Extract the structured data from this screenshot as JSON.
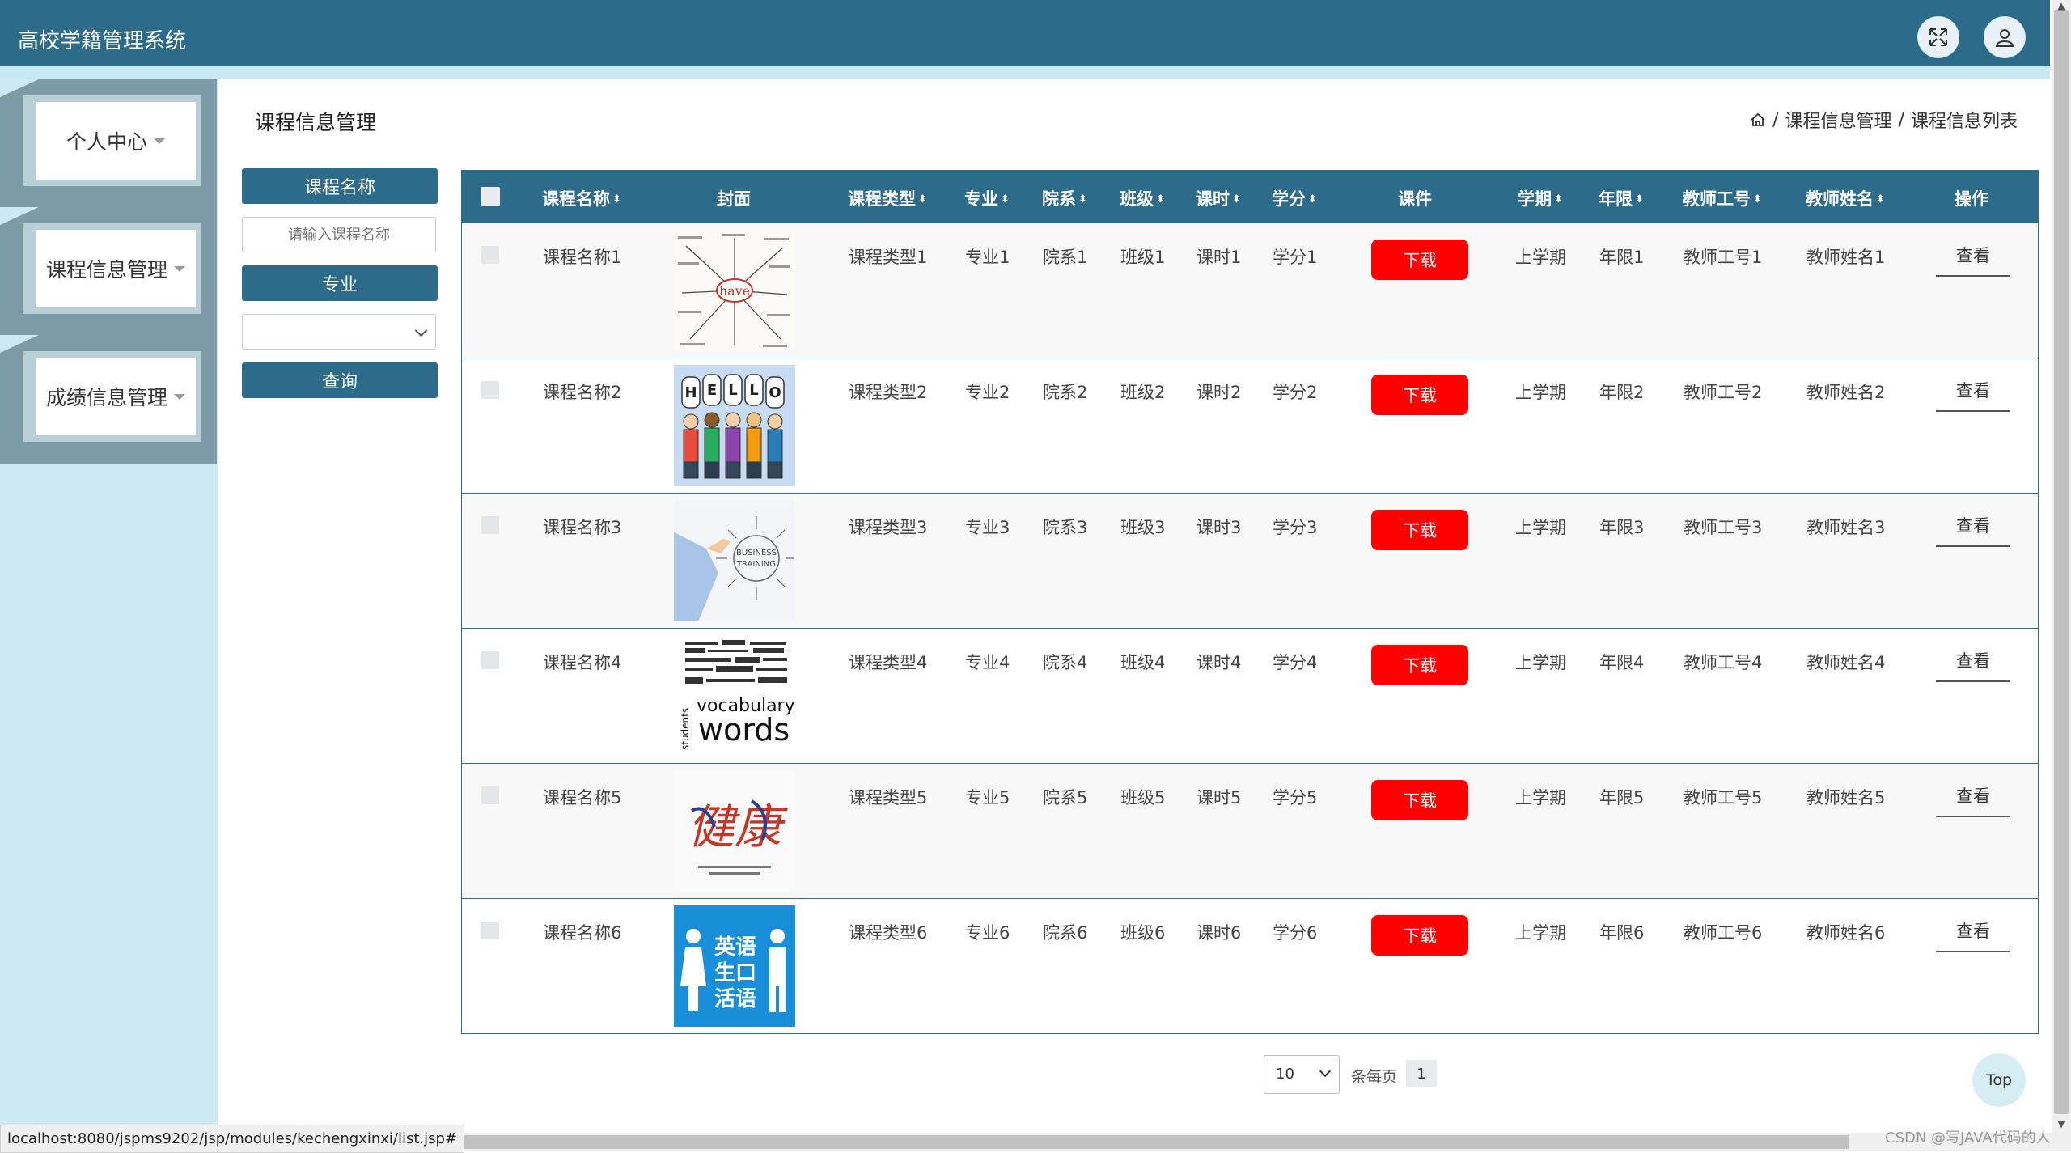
{
  "app": {
    "title": "高校学籍管理系统"
  },
  "header": {
    "fullscreen_icon": "expand-arrows-icon",
    "user_icon": "user-icon"
  },
  "sidebar": {
    "items": [
      {
        "label": "个人中心"
      },
      {
        "label": "课程信息管理"
      },
      {
        "label": "成绩信息管理"
      }
    ]
  },
  "page": {
    "title": "课程信息管理",
    "breadcrumb": {
      "home_icon": "home-icon",
      "sep1": "/",
      "level1": "课程信息管理",
      "sep2": "/",
      "level2": "课程信息列表"
    }
  },
  "filters": {
    "name_label": "课程名称",
    "name_placeholder": "请输入课程名称",
    "major_label": "专业",
    "major_value": "",
    "query_label": "查询"
  },
  "table": {
    "columns": [
      "课程名称",
      "封面",
      "课程类型",
      "专业",
      "院系",
      "班级",
      "课时",
      "学分",
      "课件",
      "学期",
      "年限",
      "教师工号",
      "教师姓名",
      "操作"
    ],
    "rows": [
      {
        "name": "课程名称1",
        "cover": "have-words-cover",
        "type": "课程类型1",
        "major": "专业1",
        "dept": "院系1",
        "class": "班级1",
        "hours": "课时1",
        "credit": "学分1",
        "download": "下载",
        "term": "上学期",
        "years": "年限1",
        "teacher_id": "教师工号1",
        "teacher_name": "教师姓名1",
        "action": "查看"
      },
      {
        "name": "课程名称2",
        "cover": "hello-kids-cover",
        "type": "课程类型2",
        "major": "专业2",
        "dept": "院系2",
        "class": "班级2",
        "hours": "课时2",
        "credit": "学分2",
        "download": "下载",
        "term": "上学期",
        "years": "年限2",
        "teacher_id": "教师工号2",
        "teacher_name": "教师姓名2",
        "action": "查看"
      },
      {
        "name": "课程名称3",
        "cover": "business-training-cover",
        "type": "课程类型3",
        "major": "专业3",
        "dept": "院系3",
        "class": "班级3",
        "hours": "课时3",
        "credit": "学分3",
        "download": "下载",
        "term": "上学期",
        "years": "年限3",
        "teacher_id": "教师工号3",
        "teacher_name": "教师姓名3",
        "action": "查看"
      },
      {
        "name": "课程名称4",
        "cover": "vocabulary-words-cover",
        "type": "课程类型4",
        "major": "专业4",
        "dept": "院系4",
        "class": "班级4",
        "hours": "课时4",
        "credit": "学分4",
        "download": "下载",
        "term": "上学期",
        "years": "年限4",
        "teacher_id": "教师工号4",
        "teacher_name": "教师姓名4",
        "action": "查看"
      },
      {
        "name": "课程名称5",
        "cover": "health-calligraphy-cover",
        "type": "课程类型5",
        "major": "专业5",
        "dept": "院系5",
        "class": "班级5",
        "hours": "课时5",
        "credit": "学分5",
        "download": "下载",
        "term": "上学期",
        "years": "年限5",
        "teacher_id": "教师工号5",
        "teacher_name": "教师姓名5",
        "action": "查看"
      },
      {
        "name": "课程名称6",
        "cover": "english-oral-cover",
        "type": "课程类型6",
        "major": "专业6",
        "dept": "院系6",
        "class": "班级6",
        "hours": "课时6",
        "credit": "学分6",
        "download": "下载",
        "term": "上学期",
        "years": "年限6",
        "teacher_id": "教师工号6",
        "teacher_name": "教师姓名6",
        "action": "查看"
      }
    ]
  },
  "covers": {
    "c1_word": "have",
    "c2_letters": [
      "H",
      "E",
      "L",
      "L",
      "O"
    ],
    "c3_line1": "BUSINESS",
    "c3_line2": "TRAINING",
    "c4_word1": "vocabulary",
    "c4_word2": "words",
    "c4_word3": "students",
    "c5_word": "健康",
    "c6_line1": "英语",
    "c6_line2": "生口",
    "c6_line3": "活语"
  },
  "pagination": {
    "page_size": "10",
    "per_page_label": "条每页",
    "current_page": "1"
  },
  "top_button": "Top",
  "status": {
    "url": "localhost:8080/jspms9202/jsp/modules/kechengxinxi/list.jsp#"
  },
  "watermark": "CSDN @写JAVA代码的人",
  "colors": {
    "primary": "#2c6b8a",
    "sidebar_bg": "#cdeaf3",
    "download": "#ff0000"
  }
}
